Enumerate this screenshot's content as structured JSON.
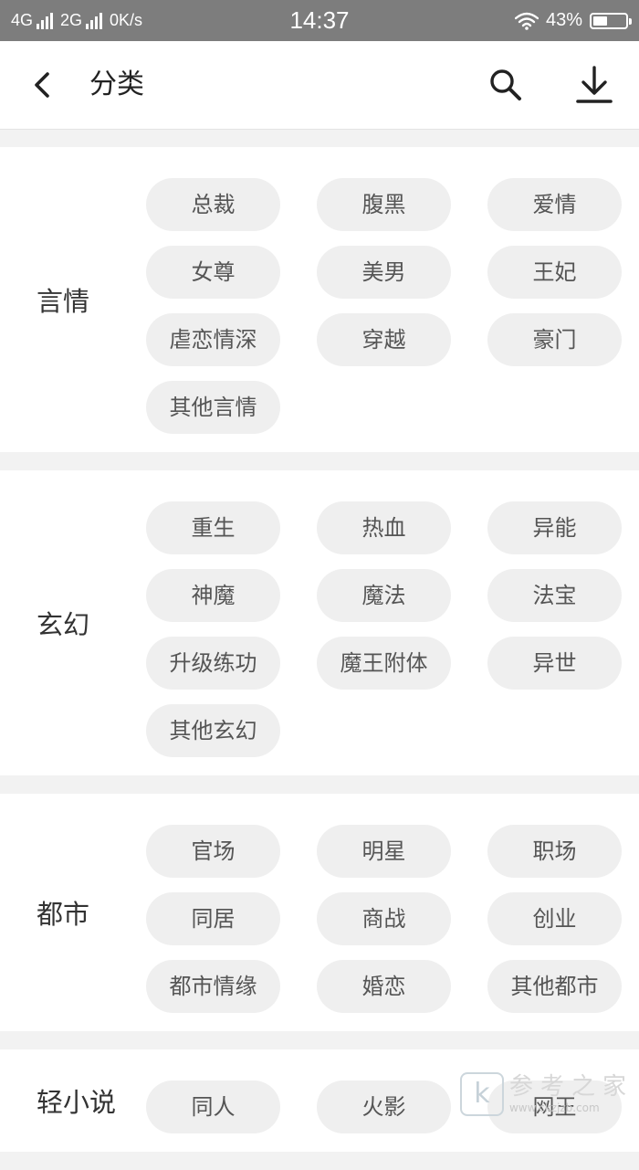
{
  "status_bar": {
    "net1": "4G",
    "net2": "2G",
    "speed": "0K/s",
    "time": "14:37",
    "battery_text": "43%",
    "battery_level": 0.43
  },
  "header": {
    "title": "分类",
    "back_icon": "chevron-left-icon",
    "search_icon": "search-icon",
    "download_icon": "download-icon"
  },
  "sections": [
    {
      "label": "言情",
      "tags": [
        "总裁",
        "腹黑",
        "爱情",
        "女尊",
        "美男",
        "王妃",
        "虐恋情深",
        "穿越",
        "豪门",
        "其他言情"
      ]
    },
    {
      "label": "玄幻",
      "tags": [
        "重生",
        "热血",
        "异能",
        "神魔",
        "魔法",
        "法宝",
        "升级练功",
        "魔王附体",
        "异世",
        "其他玄幻"
      ]
    },
    {
      "label": "都市",
      "tags": [
        "官场",
        "明星",
        "职场",
        "同居",
        "商战",
        "创业",
        "都市情缘",
        "婚恋",
        "其他都市"
      ]
    },
    {
      "label": "轻小说",
      "tags": [
        "同人",
        "火影",
        "网王"
      ]
    }
  ],
  "watermark": {
    "logo_letter": "k",
    "text": "参考之家",
    "url": "www.ckzjzb.com"
  },
  "colors": {
    "status_bar": "#7d7d7d",
    "background": "#f2f2f2",
    "tag_bg": "#efefef",
    "tag_text": "#555555"
  }
}
